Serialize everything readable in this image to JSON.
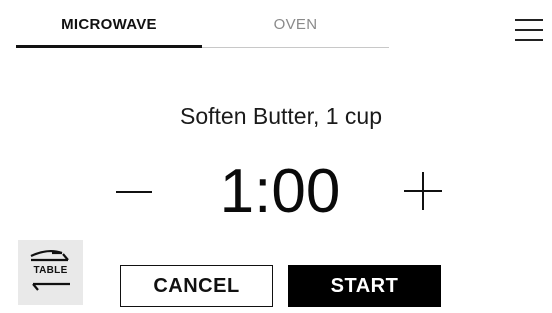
{
  "tabs": [
    {
      "label": "MICROWAVE",
      "active": true
    },
    {
      "label": "OVEN",
      "active": false
    }
  ],
  "menu": {
    "icon": "hamburger-menu-icon"
  },
  "recipe": {
    "title": "Soften Butter, 1 cup"
  },
  "timer": {
    "value": "1:00",
    "decrement_icon": "minus-icon",
    "increment_icon": "plus-icon"
  },
  "table_toggle": {
    "label": "TABLE",
    "icon": "swap-arrows-icon"
  },
  "actions": {
    "cancel_label": "CANCEL",
    "start_label": "START"
  },
  "colors": {
    "primary": "#000000",
    "active_tab_underline": "#111111",
    "inactive_tab_text": "#8a8a8a",
    "table_button_bg": "#e9e9e9"
  }
}
